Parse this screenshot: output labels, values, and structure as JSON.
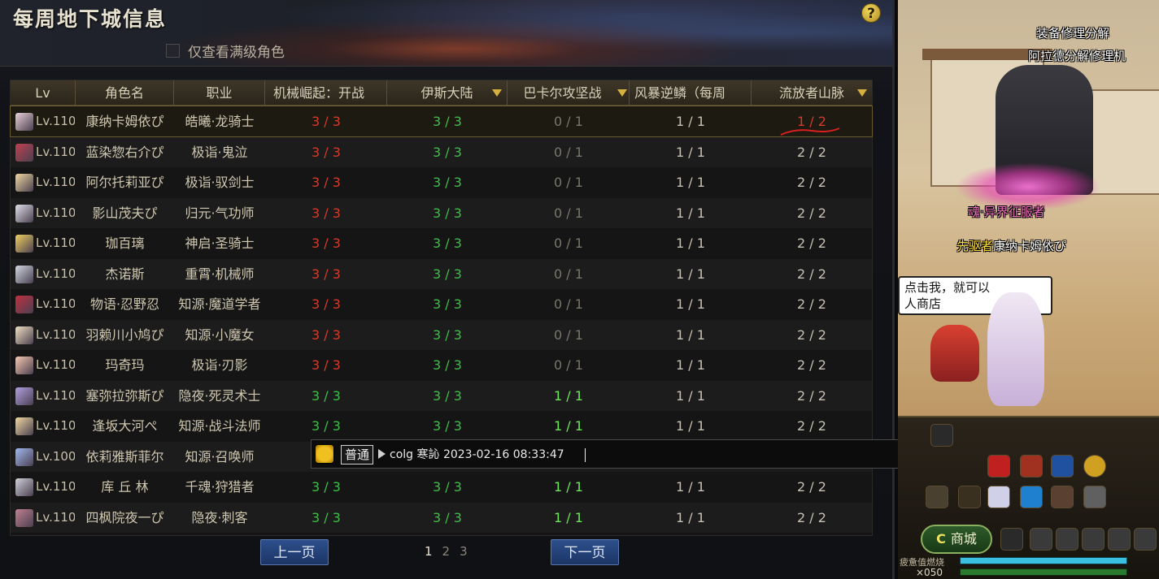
{
  "panel": {
    "title": "每周地下城信息",
    "help_icon": "?",
    "filter_label": "仅查看满级角色"
  },
  "table": {
    "headers": [
      "Lv",
      "角色名",
      "职业",
      "机械崛起：开战",
      "伊斯大陆",
      "巴卡尔攻坚战",
      "风暴逆鳞（每周",
      "流放者山脉"
    ],
    "rows": [
      {
        "lv": "Lv.110",
        "name": "康纳卡姆依ぴ",
        "job": "皓曦·龙骑士",
        "c1": "3 / 3",
        "c2": "3 / 3",
        "c3": "0 / 1",
        "c4": "1 / 1",
        "c5": "1 / 2"
      },
      {
        "lv": "Lv.110",
        "name": "蓝染惣右介ぴ",
        "job": "极诣·鬼泣",
        "c1": "3 / 3",
        "c2": "3 / 3",
        "c3": "0 / 1",
        "c4": "1 / 1",
        "c5": "2 / 2"
      },
      {
        "lv": "Lv.110",
        "name": "阿尔托莉亚ぴ",
        "job": "极诣·驭剑士",
        "c1": "3 / 3",
        "c2": "3 / 3",
        "c3": "0 / 1",
        "c4": "1 / 1",
        "c5": "2 / 2"
      },
      {
        "lv": "Lv.110",
        "name": "影山茂夫ぴ",
        "job": "归元·气功师",
        "c1": "3 / 3",
        "c2": "3 / 3",
        "c3": "0 / 1",
        "c4": "1 / 1",
        "c5": "2 / 2"
      },
      {
        "lv": "Lv.110",
        "name": "珈百璃",
        "job": "神启·圣骑士",
        "c1": "3 / 3",
        "c2": "3 / 3",
        "c3": "0 / 1",
        "c4": "1 / 1",
        "c5": "2 / 2"
      },
      {
        "lv": "Lv.110",
        "name": "杰诺斯",
        "job": "重霄·机械师",
        "c1": "3 / 3",
        "c2": "3 / 3",
        "c3": "0 / 1",
        "c4": "1 / 1",
        "c5": "2 / 2"
      },
      {
        "lv": "Lv.110",
        "name": "物语·忍野忍",
        "job": "知源·魔道学者",
        "c1": "3 / 3",
        "c2": "3 / 3",
        "c3": "0 / 1",
        "c4": "1 / 1",
        "c5": "2 / 2"
      },
      {
        "lv": "Lv.110",
        "name": "羽赖川小鸠ぴ",
        "job": "知源·小魔女",
        "c1": "3 / 3",
        "c2": "3 / 3",
        "c3": "0 / 1",
        "c4": "1 / 1",
        "c5": "2 / 2"
      },
      {
        "lv": "Lv.110",
        "name": "玛奇玛",
        "job": "极诣·刃影",
        "c1": "3 / 3",
        "c2": "3 / 3",
        "c3": "0 / 1",
        "c4": "1 / 1",
        "c5": "2 / 2"
      },
      {
        "lv": "Lv.110",
        "name": "塞弥拉弥斯ぴ",
        "job": "隐夜·死灵术士",
        "c1": "3 / 3",
        "c2": "3 / 3",
        "c3": "1 / 1",
        "c4": "1 / 1",
        "c5": "2 / 2"
      },
      {
        "lv": "Lv.110",
        "name": "逢坂大河ぺ",
        "job": "知源·战斗法师",
        "c1": "3 / 3",
        "c2": "3 / 3",
        "c3": "1 / 1",
        "c4": "1 / 1",
        "c5": "2 / 2"
      },
      {
        "lv": "Lv.100",
        "name": "依莉雅斯菲尔",
        "job": "知源·召唤师",
        "c1": "3",
        "c2": "",
        "c3": "",
        "c4": "",
        "c5": ""
      },
      {
        "lv": "Lv.110",
        "name": "库 丘 林",
        "job": "千魂·狩猎者",
        "c1": "3 / 3",
        "c2": "3 / 3",
        "c3": "1 / 1",
        "c4": "1 / 1",
        "c5": "2 / 2"
      },
      {
        "lv": "Lv.110",
        "name": "四枫院夜一ぴ",
        "job": "隐夜·刺客",
        "c1": "3 / 3",
        "c2": "3 / 3",
        "c3": "1 / 1",
        "c4": "1 / 1",
        "c5": "2 / 2"
      }
    ]
  },
  "pagination": {
    "prev_label": "上一页",
    "next_label": "下一页",
    "pages": [
      "1",
      "2",
      "3"
    ],
    "current": "1"
  },
  "chat": {
    "channel": "普通",
    "text": "colg 寒訫 2023-02-16 08:33:47"
  },
  "world": {
    "npc_title": "装备修理分解",
    "npc_name": "阿拉德分解修理机",
    "guild": "魂·异界征服者",
    "player_tag": "先驱者",
    "player_name": "康纳卡姆依ぴ",
    "bubble_text": "点击我，就可以\n人商店",
    "shop_label": "商城",
    "shop_icon": "C",
    "fatigue_label": "疲惫值燃烧",
    "count": "×050"
  },
  "colors": {
    "red_value": "#d83a2a",
    "green_value": "#3ebe48",
    "gray_value": "#7a766c",
    "header_accent": "#d8b040",
    "button_blue": "#2d4f8c"
  }
}
